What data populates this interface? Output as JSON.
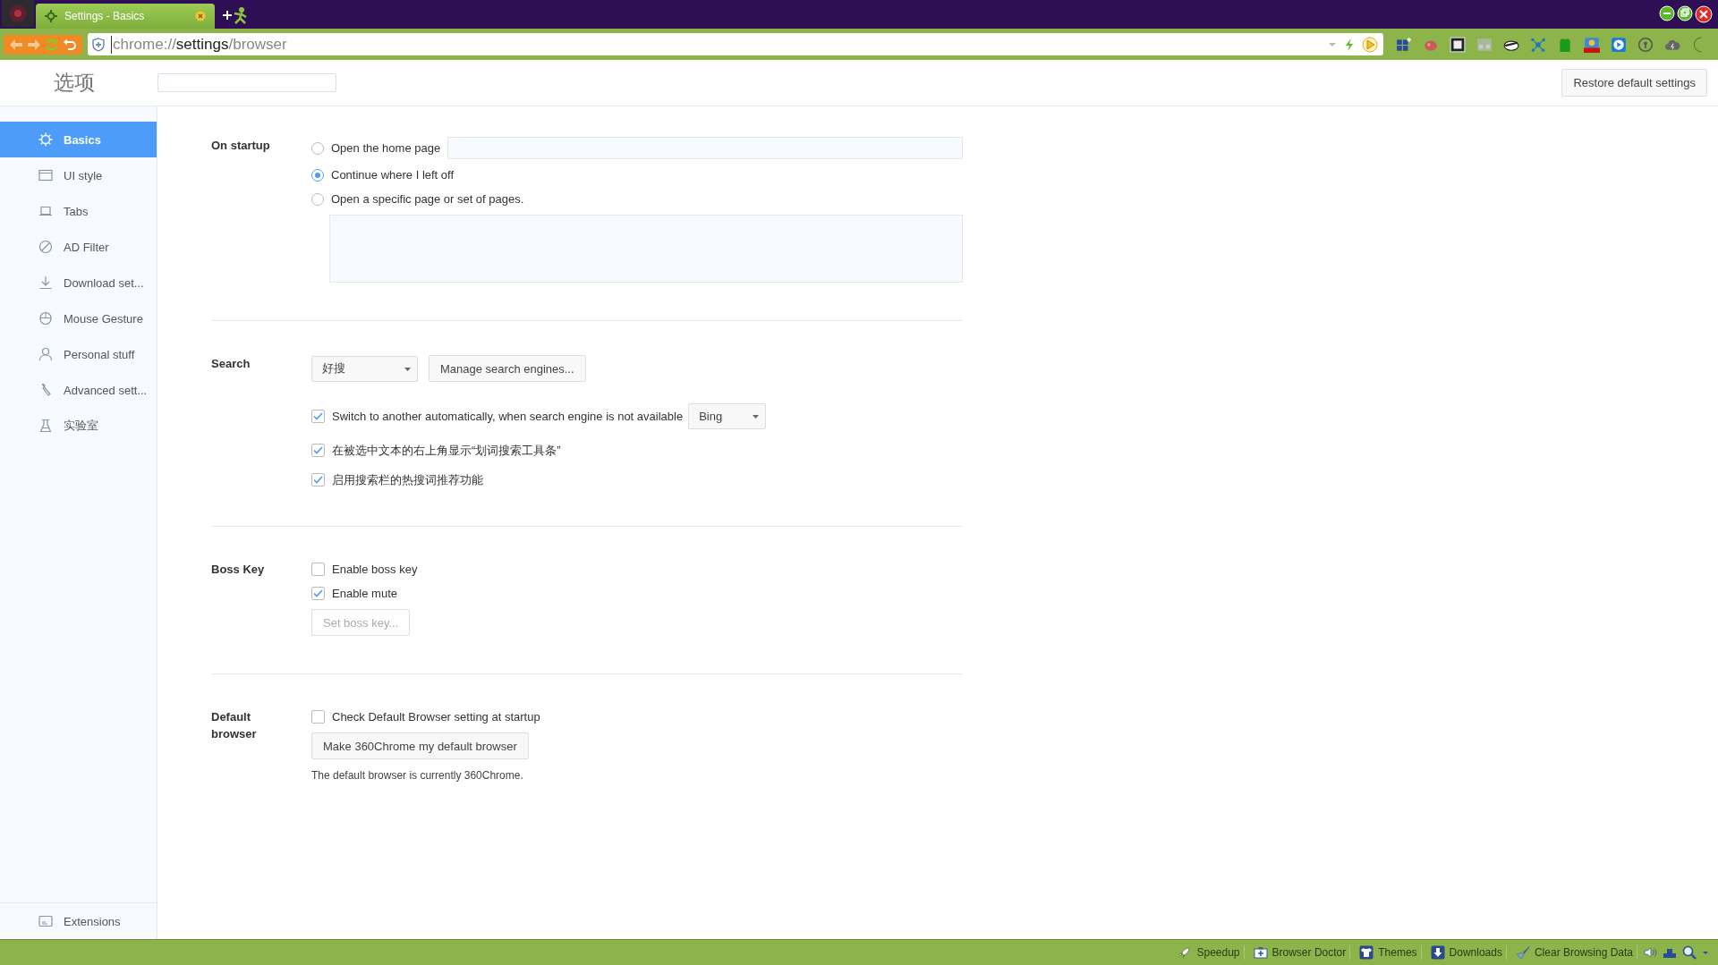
{
  "browser_tab": {
    "title": "Settings - Basics",
    "selected": true
  },
  "address_bar": {
    "segments": [
      {
        "text": "chrome://",
        "kind": "dim"
      },
      {
        "text": "settings",
        "kind": "host"
      },
      {
        "text": "/browser",
        "kind": "dim"
      }
    ]
  },
  "settings_header": {
    "title": "选项",
    "restore_button": "Restore default settings"
  },
  "sidebar": {
    "items": [
      {
        "label": "Basics",
        "selected": true
      },
      {
        "label": "UI style",
        "selected": false
      },
      {
        "label": "Tabs",
        "selected": false
      },
      {
        "label": "AD Filter",
        "selected": false
      },
      {
        "label": "Download set...",
        "selected": false
      },
      {
        "label": "Mouse Gesture",
        "selected": false
      },
      {
        "label": "Personal stuff",
        "selected": false
      },
      {
        "label": "Advanced sett...",
        "selected": false
      },
      {
        "label": "实验室",
        "selected": false
      }
    ],
    "footer_item": "Extensions"
  },
  "sections": [
    {
      "label": "On startup",
      "rows": [
        {
          "kind": "radio_with_field",
          "label": "Open the home page",
          "selected": false
        },
        {
          "kind": "radio",
          "label": "Continue where I left off",
          "selected": true
        },
        {
          "kind": "radio",
          "label": "Open a specific page or set of pages.",
          "selected": false
        },
        {
          "kind": "textarea"
        }
      ]
    },
    {
      "label": "Search",
      "rows": [
        {
          "kind": "select_button",
          "value": "好搜",
          "button": "Manage search engines..."
        },
        {
          "kind": "checkbox",
          "label": "Switch to another automatically, when search engine is not available",
          "checked": true,
          "select": "Bing"
        },
        {
          "kind": "checkbox",
          "label": "在被选中文本的右上角显示“划词搜索工具条”",
          "checked": true
        },
        {
          "kind": "checkbox",
          "label": "启用搜索栏的热搜词推荐功能",
          "checked": true
        }
      ]
    },
    {
      "label": "Boss Key",
      "rows": [
        {
          "kind": "checkbox",
          "label": "Enable boss key",
          "checked": false
        },
        {
          "kind": "checkbox",
          "label": "Enable mute",
          "checked": true
        },
        {
          "kind": "button",
          "label": "Set boss key...",
          "disabled": true
        }
      ]
    },
    {
      "label": "Default browser",
      "rows": [
        {
          "kind": "checkbox",
          "label": "Check Default Browser setting at startup",
          "checked": false
        },
        {
          "kind": "button",
          "label": "Make 360Chrome my default browser",
          "disabled": false
        },
        {
          "kind": "note",
          "label": "The default browser is currently 360Chrome."
        }
      ]
    }
  ],
  "status_bar": {
    "items": [
      {
        "label": "Speedup"
      },
      {
        "label": "Browser Doctor"
      },
      {
        "label": "Themes"
      },
      {
        "label": "Downloads"
      },
      {
        "label": "Clear Browsing Data"
      }
    ]
  }
}
